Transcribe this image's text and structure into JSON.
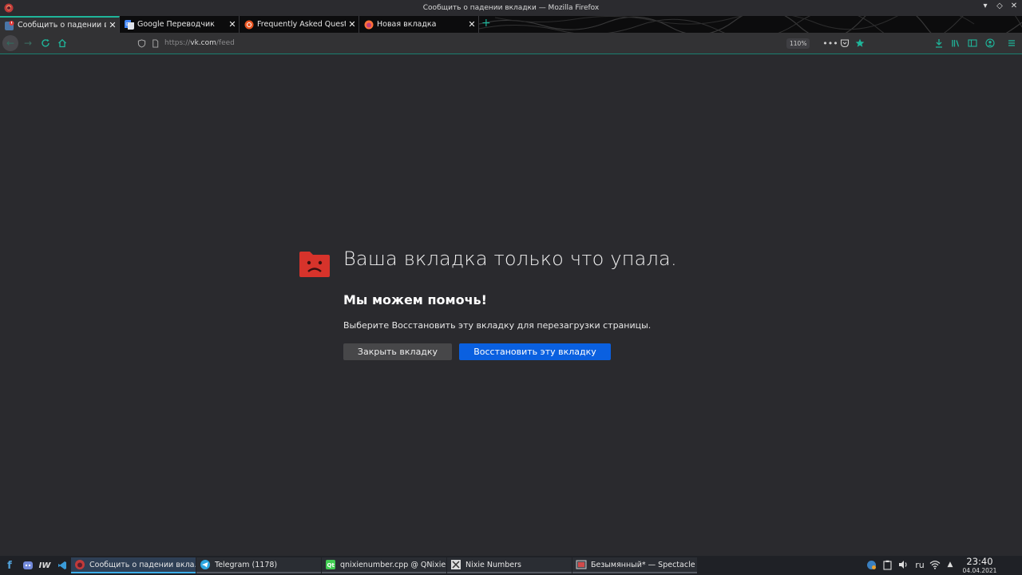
{
  "window": {
    "title": "Сообщить о падении вкладки — Mozilla Firefox",
    "controls": [
      "▾",
      "◇",
      "✕"
    ]
  },
  "tabs": [
    {
      "label": "Сообщить о падении вкладки",
      "favicon": "vk-crash-icon",
      "active": true
    },
    {
      "label": "Google Переводчик",
      "favicon": "google-translate-icon",
      "active": false
    },
    {
      "label": "Frequently Asked Questions",
      "favicon": "ubuntu-icon",
      "active": false
    },
    {
      "label": "Новая вкладка",
      "favicon": "firefox-icon",
      "active": false
    }
  ],
  "newtab_symbol": "+",
  "navbar": {
    "url_prefix": "https://",
    "url_host": "vk.com",
    "url_path": "/feed",
    "zoom": "110%"
  },
  "crash": {
    "title": "Ваша вкладка только что упала.",
    "subtitle": "Мы можем помочь!",
    "description": "Выберите Восстановить эту вкладку для перезагрузки страницы.",
    "close_button": "Закрыть вкладку",
    "restore_button": "Восстановить эту вкладку"
  },
  "taskbar": {
    "tasks": [
      {
        "label": "Сообщить о падении вкла...",
        "icon": "firefox-icon",
        "active": true
      },
      {
        "label": "Telegram (1178)",
        "icon": "telegram-icon",
        "active": false
      },
      {
        "label": "qnixienumber.cpp @ QNixie...",
        "icon": "qtcreator-icon",
        "active": false
      },
      {
        "label": "Nixie Numbers",
        "icon": "nixie-app-icon",
        "active": false
      },
      {
        "label": "Безымянный* — Spectacle",
        "icon": "spectacle-icon",
        "active": false
      }
    ],
    "keyboard_layout": "ru",
    "time": "23:40",
    "date": "04.04.2021"
  },
  "colors": {
    "accent": "#1fb59a",
    "restore_button": "#0a60e0",
    "crash_icon": "#d7332b",
    "background": "#2a2a2e"
  }
}
